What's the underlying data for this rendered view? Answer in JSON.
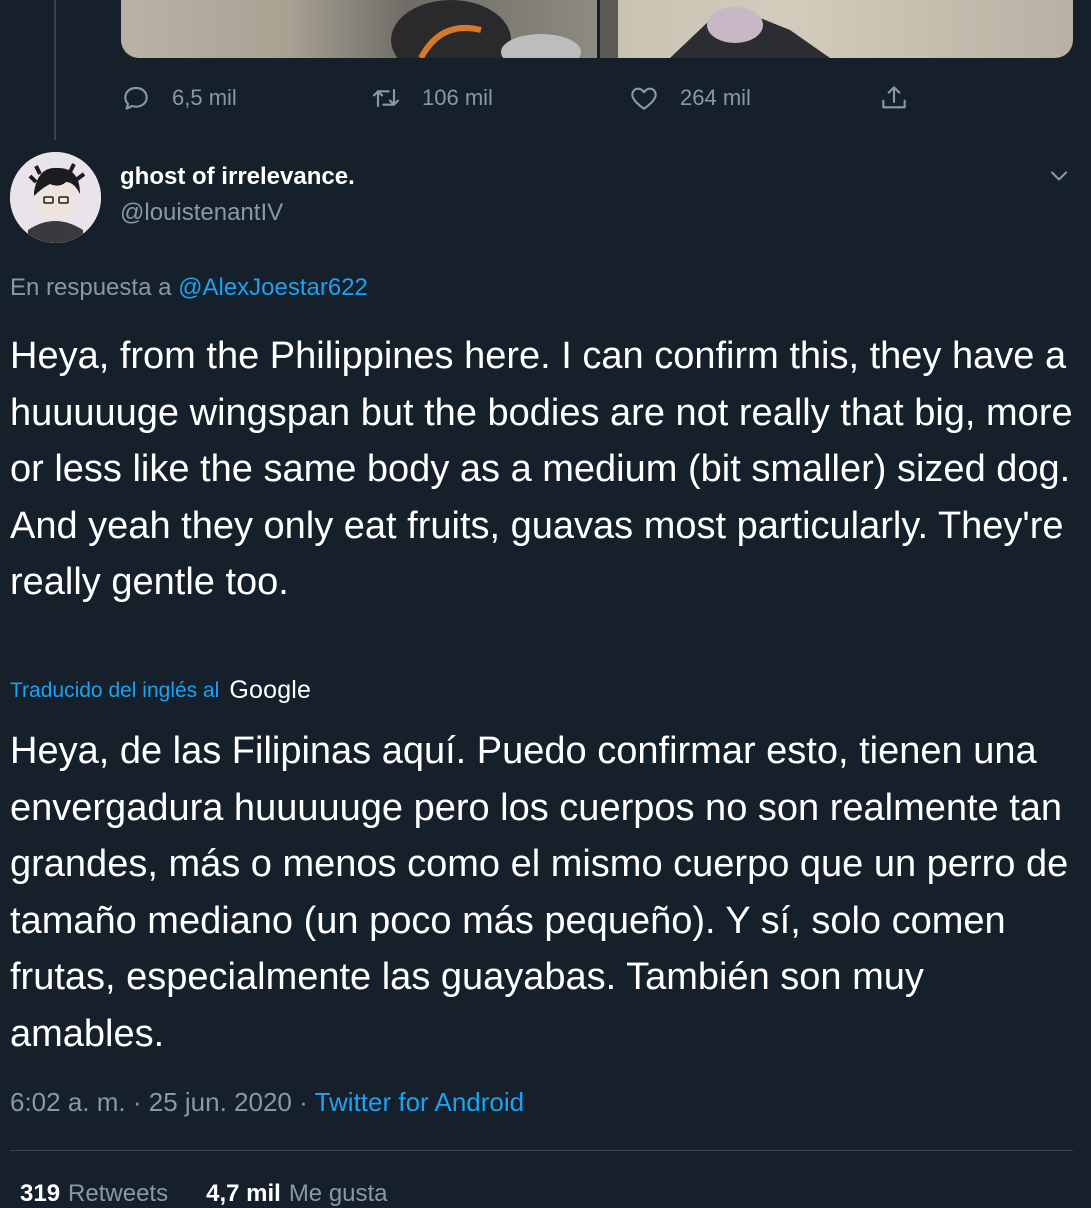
{
  "previous_tweet": {
    "actions": {
      "replies": "6,5 mil",
      "retweets": "106 mil",
      "likes": "264 mil"
    }
  },
  "tweet": {
    "author": {
      "name": "ghost of irrelevance.",
      "handle": "@louistenantIV"
    },
    "reply_prefix": "En respuesta a",
    "reply_mention": "@AlexJoestar622",
    "text": "Heya, from the Philippines here. I can confirm this, they have a huuuuuge wingspan but the bodies are not really that big, more or less like the same body as a medium (bit smaller) sized dog. And yeah they only eat fruits, guavas most particularly. They're really gentle too.",
    "translated_label": "Traducido del inglés al",
    "translator": "Google",
    "translation": "Heya, de las Filipinas aquí. Puedo confirmar esto, tienen una envergadura huuuuuge pero los cuerpos no son realmente tan grandes, más o menos como el mismo cuerpo que un perro de tamaño mediano (un poco más pequeño). Y sí, solo comen frutas, especialmente las guayabas. También son muy amables.",
    "time": "6:02 a. m.",
    "separator": "·",
    "date": "25 jun. 2020",
    "source": "Twitter for Android",
    "stats": {
      "retweets_count": "319",
      "retweets_label": "Retweets",
      "likes_count": "4,7 mil",
      "likes_label": "Me gusta"
    }
  },
  "colors": {
    "background": "#15202b",
    "secondary_text": "#8899a6",
    "accent": "#1da1f2",
    "divider": "#38444d"
  },
  "icons": [
    "reply-icon",
    "retweet-icon",
    "like-icon",
    "share-icon",
    "chevron-down-icon"
  ]
}
